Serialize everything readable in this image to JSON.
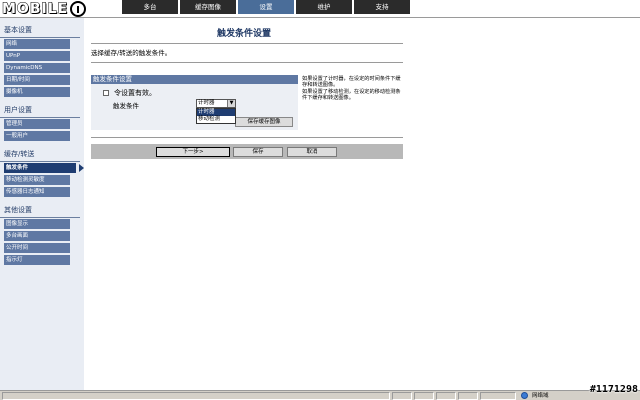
{
  "logo": {
    "text": "MOBILE",
    "mark": "01"
  },
  "tabs": [
    {
      "label": "多台",
      "active": false
    },
    {
      "label": "缓存图像",
      "active": false
    },
    {
      "label": "设置",
      "active": true
    },
    {
      "label": "维护",
      "active": false
    },
    {
      "label": "支持",
      "active": false
    }
  ],
  "sidebar": {
    "sections": [
      {
        "title": "基本设置",
        "items": [
          "网络",
          "UPnP",
          "DynamicDNS",
          "日期/时间",
          "摄像机"
        ]
      },
      {
        "title": "用户设置",
        "items": [
          "管理员",
          "一般用户"
        ]
      },
      {
        "title": "缓存/转送",
        "items": [
          "触发条件",
          "移动检测灵敏度",
          "传感器日志通知"
        ]
      },
      {
        "title": "其他设置",
        "items": [
          "图像显示",
          "多台画面",
          "公开时间",
          "指示灯"
        ]
      }
    ],
    "current": "触发条件"
  },
  "main": {
    "title": "触发条件设置",
    "instruction": "选择缓存/转送的触发条件。",
    "box_title": "触发条件设置",
    "checkbox_label": "令设置有效。",
    "cond_label": "触发条件",
    "select_value": "计时器",
    "dropdown_options": [
      "计时器",
      "移动检测"
    ],
    "save_image_button": "保存缓存图像",
    "note": "如果设置了计时器，在设定的时间条件下缓存和转送图像。\n如果设置了移动检测，在设定的移动检测条件下缓存和转送图像。",
    "buttons": {
      "next": "下一步>",
      "save": "保存",
      "cancel": "取消"
    }
  },
  "statusbar": {
    "zone": "网络域"
  },
  "watermark": "#1171298",
  "colors": {
    "nav_blue": "#5f78a3",
    "nav_dark": "#1f3d72",
    "tab_active": "#4a6d99",
    "title_blue": "#213a66"
  }
}
